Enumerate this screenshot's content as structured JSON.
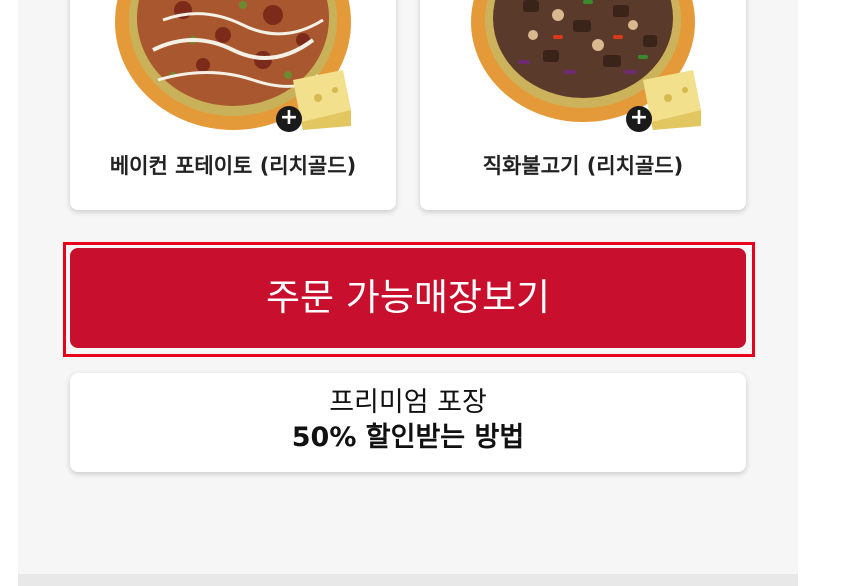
{
  "menu": {
    "items": [
      {
        "name": "베이컨 포테이토 (리치골드)"
      },
      {
        "name": "직화불고기 (리치골드)"
      }
    ],
    "add_symbol": "+"
  },
  "order": {
    "label": "주문 가능매장보기"
  },
  "promo": {
    "line1": "프리미엄 포장",
    "line2": "50% 할인받는 방법"
  },
  "colors": {
    "primary": "#c8102e",
    "highlight": "#e8001c",
    "background": "#f6f6f6"
  }
}
